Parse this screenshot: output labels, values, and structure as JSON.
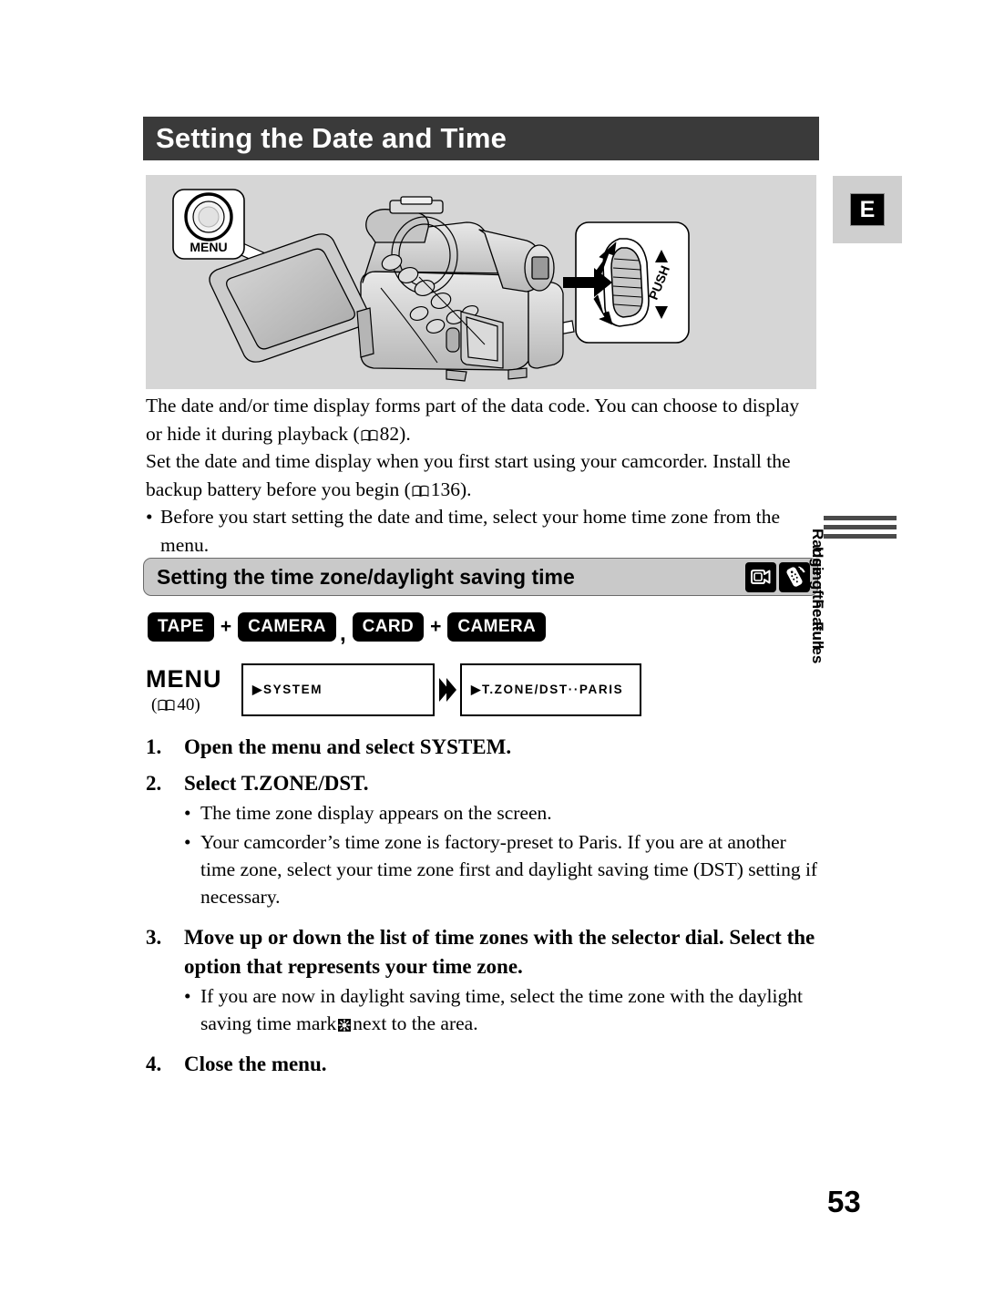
{
  "document": {
    "title": "Setting the Date and Time",
    "language_tab": "E",
    "page_number": "53"
  },
  "illustration": {
    "menu_callout_label": "MENU",
    "dial_callout_label": "PUSH"
  },
  "intro": {
    "paragraph_1": "The date and/or time display forms part of the data code. You can choose to display or hide it during playback (",
    "paragraph_1_ref": "82",
    "paragraph_1_end": ").",
    "paragraph_2": "Set the date and time display when you first start using your camcorder. Install the backup battery before you begin (",
    "paragraph_2_ref": "136",
    "paragraph_2_end": ").",
    "bullet_dot": "•",
    "bullet_1": "Before you start setting the date and time, select your home time zone from the menu."
  },
  "subsection": {
    "heading": "Setting the time zone/daylight saving time",
    "icons": [
      "camcorder-icon",
      "remote-icon"
    ]
  },
  "modes": {
    "badge_1": "TAPE",
    "plus_1": "+",
    "badge_2": "CAMERA",
    "separator": ",",
    "badge_3": "CARD",
    "plus_2": "+",
    "badge_4": "CAMERA"
  },
  "menu_nav": {
    "menu_label": "MENU",
    "menu_ref_open": "(",
    "menu_ref": "40",
    "menu_ref_close": ")",
    "box_1": "▶SYSTEM",
    "box_2": "▶T.ZONE/DST··PARIS"
  },
  "steps": [
    {
      "number": "1.",
      "heading": "Open the menu and select SYSTEM.",
      "bullets": []
    },
    {
      "number": "2.",
      "heading": "Select T.ZONE/DST.",
      "bullets": [
        "The time zone display appears on the screen.",
        "Your camcorder’s time zone is factory-preset to Paris. If you are at another time zone, select your time zone first and daylight saving time (DST) setting if necessary."
      ]
    },
    {
      "number": "3.",
      "heading": "Move up or down the list of time zones with the selector dial. Select the option that represents your time zone.",
      "bullets": [],
      "bullet_with_mark_pre": "If you are now in daylight saving time, select the time zone with the daylight saving time mark",
      "bullet_with_mark_post": "next to the area."
    },
    {
      "number": "4.",
      "heading": "Close the menu.",
      "bullets": []
    }
  ],
  "bullet_dot": "•",
  "side_tab": {
    "line_1": "Using the Full",
    "line_2": "Range of Features"
  },
  "colors": {
    "title_bar_bg": "#3a3a3a",
    "illustration_bg": "#d6d6d6",
    "subsection_bg": "#c9c9c9",
    "side_tab_bar": "#4a4a4a",
    "badge_bg": "#000000"
  }
}
